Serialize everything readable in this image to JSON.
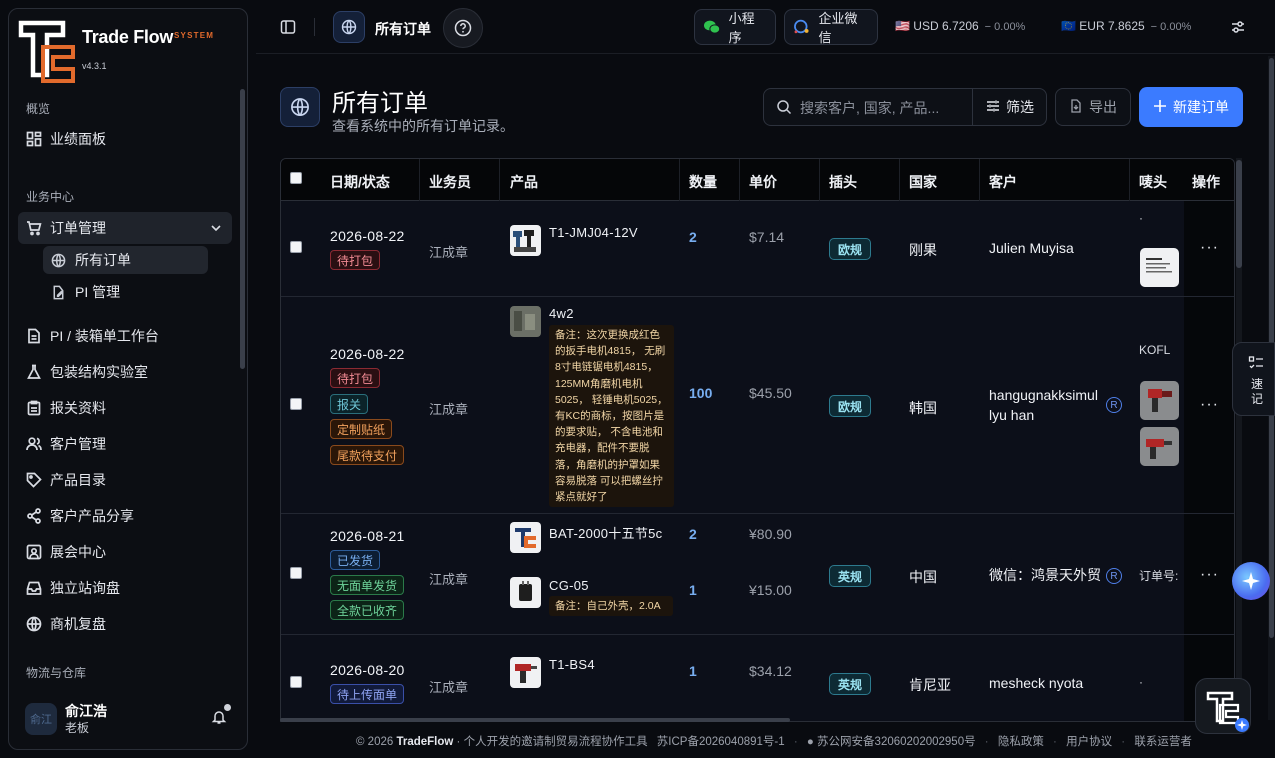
{
  "brand": {
    "name": "Trade Flow",
    "system": "SYSTEM",
    "version": "v4.3.1"
  },
  "sidebar": {
    "sections": [
      "概览",
      "业务中心",
      "物流与仓库"
    ],
    "items": {
      "dashboard": "业绩面板",
      "orders": "订单管理",
      "all_orders": "所有订单",
      "pi": "PI 管理",
      "workbench": "PI / 装箱单工作台",
      "packlab": "包装结构实验室",
      "customs": "报关资料",
      "customers": "客户管理",
      "catalog": "产品目录",
      "share": "客户产品分享",
      "expo": "展会中心",
      "site": "独立站询盘",
      "review": "商机复盘"
    },
    "user": {
      "avatar": "俞江",
      "name": "俞江浩",
      "role": "老板"
    }
  },
  "topbar": {
    "breadcrumb": "所有订单",
    "miniprogram": "小程序",
    "wecom": "企业微信",
    "usd": {
      "flag": "🇺🇸",
      "label": "USD 6.7206",
      "change": "− 0.00%"
    },
    "eur": {
      "flag": "🇪🇺",
      "label": "EUR 7.8625",
      "change": "− 0.00%"
    }
  },
  "page": {
    "title": "所有订单",
    "subtitle": "查看系统中的所有订单记录。",
    "search_placeholder": "搜索客户, 国家, 产品...",
    "filter": "筛选",
    "export": "导出",
    "new_order": "新建订单"
  },
  "table": {
    "headers": [
      "日期/状态",
      "业务员",
      "产品",
      "数量",
      "单价",
      "插头",
      "国家",
      "客户",
      "唛头",
      "操作"
    ],
    "rows": [
      {
        "date": "2026-08-22",
        "tags": [
          "待打包"
        ],
        "sales": "江成章",
        "products": [
          {
            "name": "T1-JMJ04-12V",
            "qty": "2",
            "price": "$7.14"
          }
        ],
        "plug": "欧规",
        "country": "刚果",
        "customer": "Julien Muyisa",
        "mark": "·"
      },
      {
        "date": "2026-08-22",
        "tags": [
          "待打包",
          "报关",
          "定制贴纸",
          "尾款待支付"
        ],
        "sales": "江成章",
        "products": [
          {
            "name": "4w2",
            "note": "备注：这次更换成红色的扳手电机4815， 无刷8寸电链锯电机4815，125MM角磨机电机5025， 轻锤电机5025， 有KC的商标，按图片是的要求贴， 不含电池和充电器，配件不要脱落，角磨机的护罩如果容易脱落 可以把螺丝拧紧点就好了",
            "qty": "100",
            "price": "$45.50"
          }
        ],
        "plug": "欧规",
        "country": "韩国",
        "customer": "hangugnakksimullyu han",
        "reg": "R",
        "mark": "KOFL"
      },
      {
        "date": "2026-08-21",
        "tags": [
          "已发货",
          "无面单发货",
          "全款已收齐"
        ],
        "sales": "江成章",
        "products": [
          {
            "name": "BAT-2000十五节5c",
            "qty": "2",
            "price": "¥80.90"
          },
          {
            "name": "CG-05",
            "note": "备注：自己外壳，2.0A",
            "qty": "1",
            "price": "¥15.00"
          }
        ],
        "plug": "英规",
        "country": "中国",
        "customer": "微信：鸿景天外贸",
        "reg": "R",
        "mark": "订单号:"
      },
      {
        "date": "2026-08-20",
        "tags": [
          "待上传面单"
        ],
        "sales": "江成章",
        "products": [
          {
            "name": "T1-BS4",
            "qty": "1",
            "price": "$34.12"
          }
        ],
        "plug": "英规",
        "country": "肯尼亚",
        "customer": "mesheck nyota",
        "mark": "·"
      }
    ]
  },
  "side_tab": "速记",
  "footer": {
    "copyright": "© 2026",
    "brand": "TradeFlow",
    "desc": "· 个人开发的邀请制贸易流程协作工具",
    "icp": "苏ICP备2026040891号-1",
    "police": "苏公网安备32060202002950号",
    "privacy": "隐私政策",
    "terms": "用户协议",
    "contact": "联系运营者"
  },
  "colors": {
    "accent": "#3b7bff",
    "brand_orange": "#e26a2c",
    "bg": "#090b10"
  }
}
